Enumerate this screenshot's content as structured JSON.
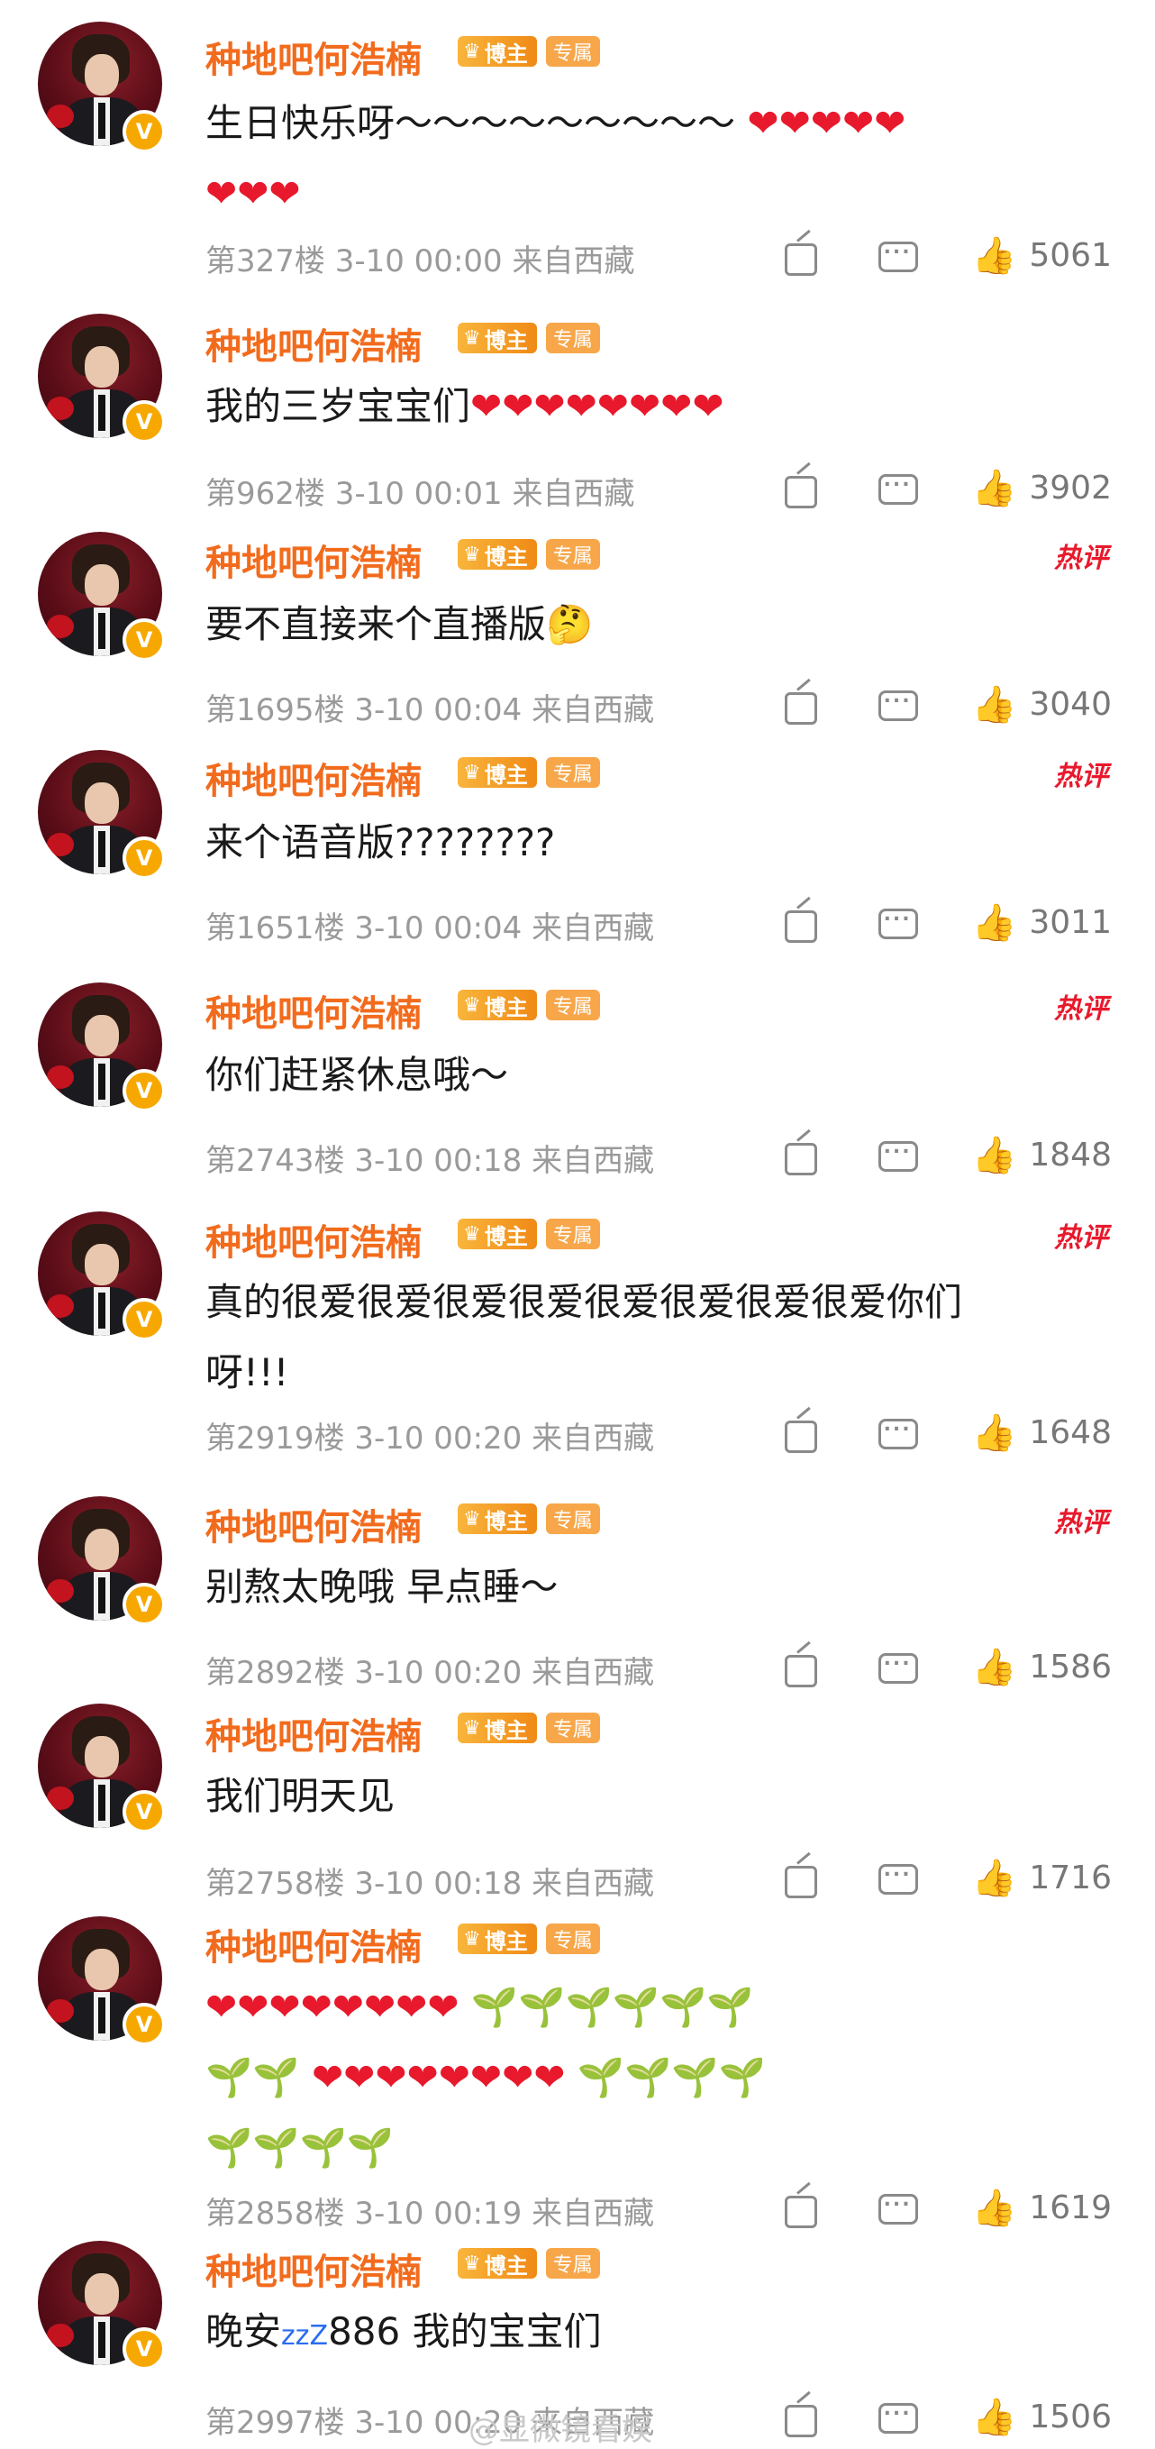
{
  "comments": [
    {
      "user": "种地吧何浩楠",
      "badge_blogger": "博主",
      "badge_exclusive": "专属",
      "text": "生日快乐呀～～～～～～～～～",
      "hearts": "❤❤❤❤❤",
      "line2": "❤❤❤",
      "meta": "第327楼  3-10 00:00  来自西藏",
      "likes": "5061"
    },
    {
      "user": "种地吧何浩楠",
      "badge_blogger": "博主",
      "badge_exclusive": "专属",
      "text": "我的三岁宝宝们",
      "hearts": "❤❤❤❤❤❤❤❤",
      "meta": "第962楼  3-10 00:01  来自西藏",
      "likes": "3902"
    },
    {
      "user": "种地吧何浩楠",
      "badge_blogger": "博主",
      "badge_exclusive": "专属",
      "hot": "热评",
      "text": "要不直接来个直播版",
      "emoji": "🤔",
      "meta": "第1695楼  3-10 00:04  来自西藏",
      "likes": "3040"
    },
    {
      "user": "种地吧何浩楠",
      "badge_blogger": "博主",
      "badge_exclusive": "专属",
      "hot": "热评",
      "text": "来个语音版????????",
      "meta": "第1651楼  3-10 00:04  来自西藏",
      "likes": "3011"
    },
    {
      "user": "种地吧何浩楠",
      "badge_blogger": "博主",
      "badge_exclusive": "专属",
      "hot": "热评",
      "text": "你们赶紧休息哦～",
      "meta": "第2743楼  3-10 00:18  来自西藏",
      "likes": "1848"
    },
    {
      "user": "种地吧何浩楠",
      "badge_blogger": "博主",
      "badge_exclusive": "专属",
      "hot": "热评",
      "text": "真的很爱很爱很爱很爱很爱很爱很爱很爱你们",
      "line2": "呀!!!",
      "meta": "第2919楼  3-10 00:20  来自西藏",
      "likes": "1648"
    },
    {
      "user": "种地吧何浩楠",
      "badge_blogger": "博主",
      "badge_exclusive": "专属",
      "hot": "热评",
      "text": "别熬太晚哦  早点睡～",
      "meta": "第2892楼  3-10 00:20  来自西藏",
      "likes": "1586"
    },
    {
      "user": "种地吧何浩楠",
      "badge_blogger": "博主",
      "badge_exclusive": "专属",
      "text": "我们明天见",
      "meta": "第2758楼  3-10 00:18  来自西藏",
      "likes": "1716"
    },
    {
      "user": "种地吧何浩楠",
      "badge_blogger": "博主",
      "badge_exclusive": "专属",
      "text_line1_hearts": "❤❤❤❤❤❤❤❤",
      "text_line1_sprouts": "🌱🌱🌱🌱🌱🌱",
      "text_line2_sprouts_a": "🌱🌱",
      "text_line2_hearts": "❤❤❤❤❤❤❤❤",
      "text_line2_sprouts_b": "🌱🌱🌱🌱",
      "text_line3_sprouts": "🌱🌱🌱🌱",
      "meta": "第2858楼  3-10 00:19  来自西藏",
      "likes": "1619"
    },
    {
      "user": "种地吧何浩楠",
      "badge_blogger": "博主",
      "badge_exclusive": "专属",
      "text_a": "晚安",
      "zzz": "zzZ",
      "text_b": "886 我的宝宝们",
      "meta": "第2997楼  3-10 00:20  来自西藏",
      "likes": "1506"
    }
  ],
  "watermark": "@显微镜看娱",
  "icons": {
    "avatar": "avatar-image",
    "verified": "verified-v-icon",
    "share": "share-icon",
    "reply": "comment-icon",
    "like": "thumbs-up-icon"
  },
  "colors": {
    "username": "#f26b1d",
    "hot_label": "#e8192c",
    "meta": "#9a9a9a",
    "heart": "#e8192c",
    "sprout": "#54b43c"
  }
}
